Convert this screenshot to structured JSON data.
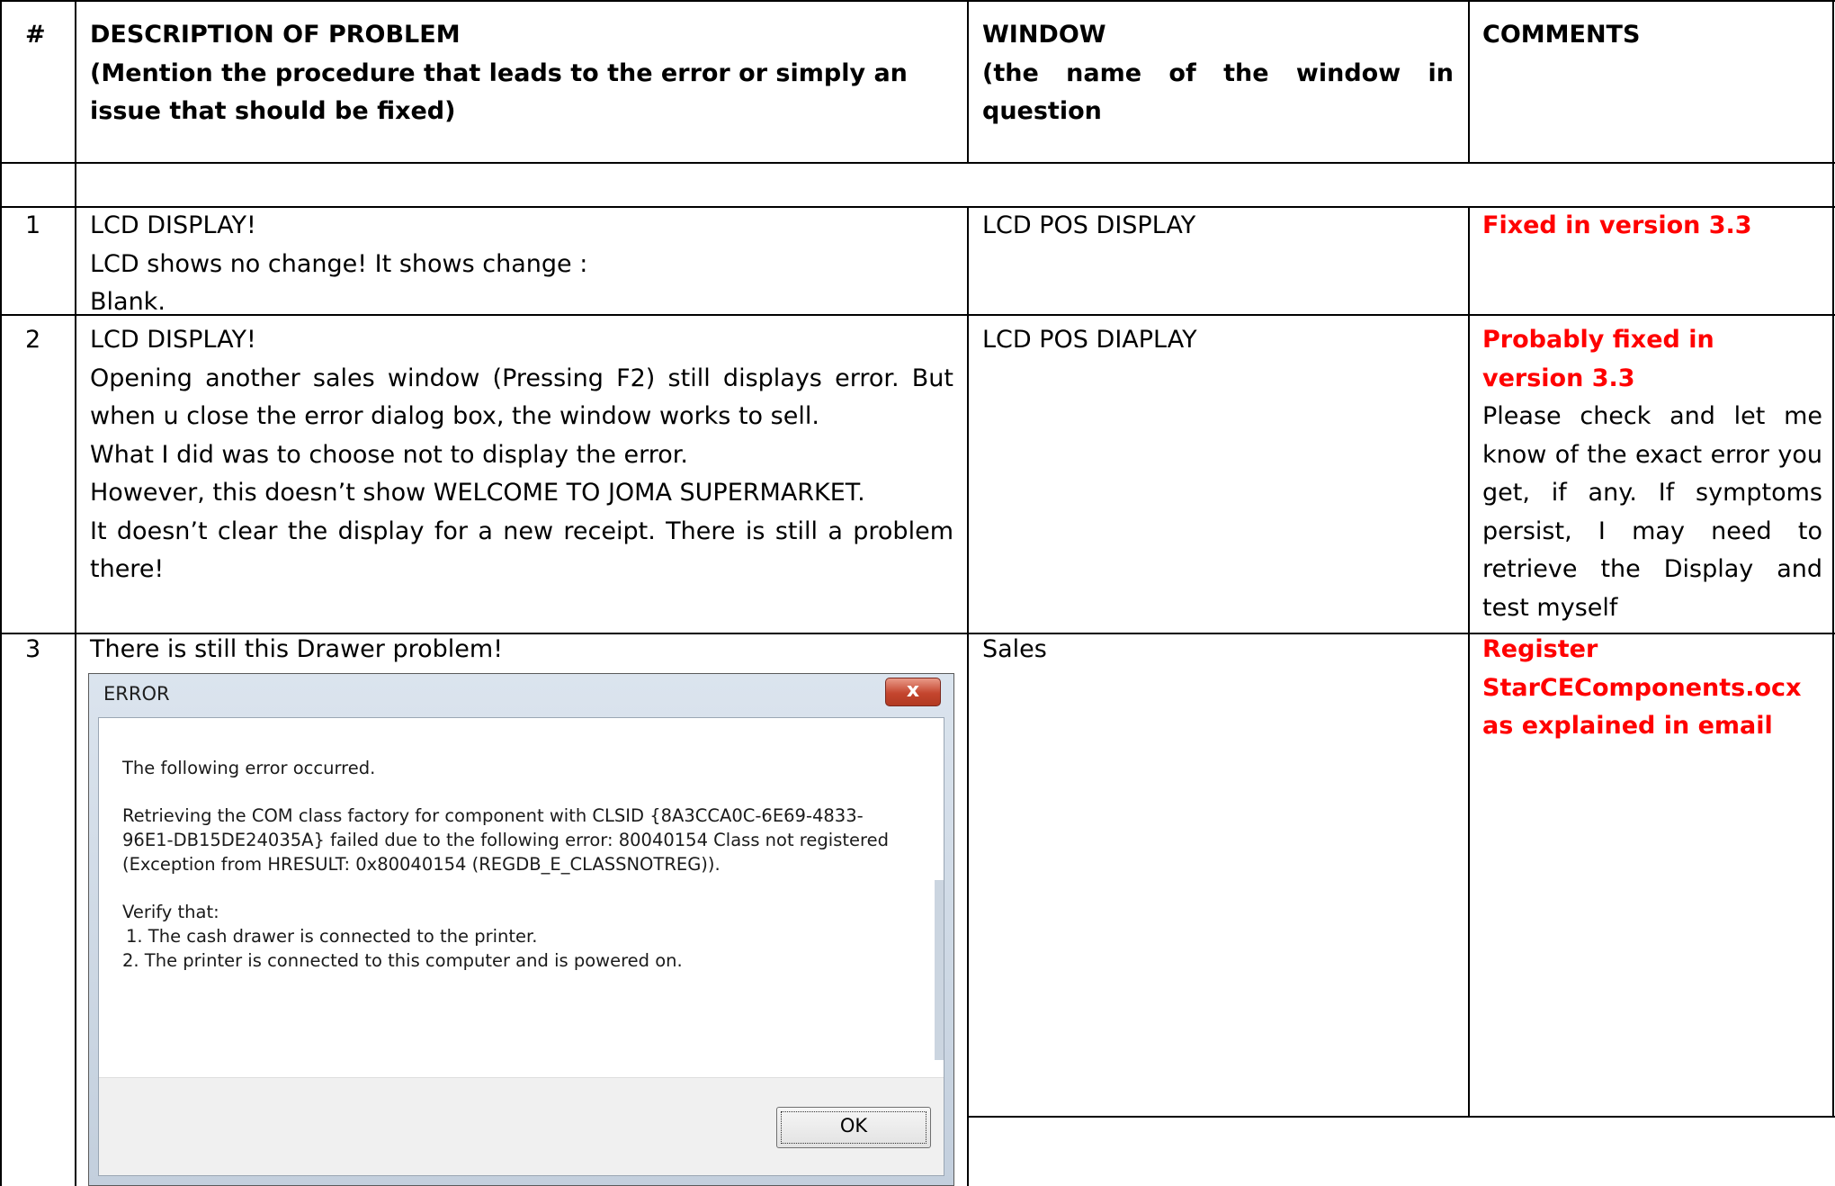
{
  "header": {
    "num": "#",
    "description_title": "DESCRIPTION OF PROBLEM",
    "description_sub": "(Mention the procedure that leads to the error or simply an issue that should be fixed)",
    "window_title": "WINDOW",
    "window_sub": "(the name of the window in question",
    "comments_title": "COMMENTS"
  },
  "rows": [
    {
      "num": "1",
      "description": [
        "LCD DISPLAY!",
        "LCD shows no change! It shows change :",
        "Blank."
      ],
      "window": "LCD POS DISPLAY",
      "comment_red": "Fixed in version 3.3",
      "comment_text": ""
    },
    {
      "num": "2",
      "description": [
        "LCD DISPLAY!",
        "Opening another sales window (Pressing F2) still displays error. But when u close the error dialog box, the window works to sell.",
        "What I did was to choose not to display the error.",
        "However, this doesn’t show WELCOME TO JOMA SUPERMARKET.",
        "It doesn’t clear the display for a new receipt. There is still a problem there!"
      ],
      "window": "LCD POS DIAPLAY",
      "comment_red": "Probably fixed in version 3.3",
      "comment_text": "Please check and let me know of the exact error you get, if any. If symptoms persist, I may need to retrieve the Display and test myself"
    },
    {
      "num": "3",
      "description": [
        "There is still this Drawer problem!"
      ],
      "window": "Sales",
      "comment_red": "Register StarCEComponents.ocx as explained in email",
      "comment_text": ""
    }
  ],
  "dialog": {
    "title": "ERROR",
    "close_glyph": "x",
    "line1": "The following error occurred.",
    "line2": "Retrieving the COM class factory for component with CLSID {8A3CCA0C-6E69-4833-96E1-DB15DE24035A} failed due to the following error: 80040154 Class not registered (Exception from HRESULT: 0x80040154 (REGDB_E_CLASSNOTREG)).",
    "verify": "Verify that:",
    "item1": "1. The cash drawer is connected to the printer.",
    "item2": "2. The printer is connected to this computer and is powered on.",
    "ok_label": "OK"
  }
}
